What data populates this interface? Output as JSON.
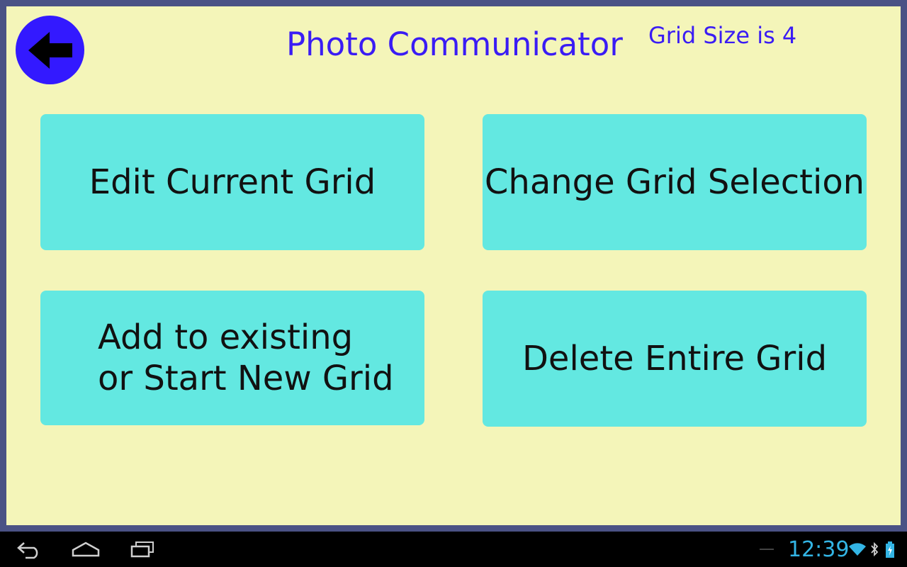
{
  "header": {
    "title": "Photo Communicator",
    "grid_size": "Grid Size is 4",
    "back_icon": "arrow-left-icon"
  },
  "menu": {
    "edit_label": "Edit Current Grid",
    "change_label": "Change Grid Selection",
    "add_label": "Add to existing\nor Start New Grid",
    "delete_label": "Delete Entire Grid"
  },
  "system_bar": {
    "time": "12:39",
    "icons": [
      "back-icon",
      "home-icon",
      "recent-apps-icon",
      "wifi-icon",
      "bluetooth-icon",
      "battery-icon"
    ]
  },
  "colors": {
    "background": "#f4f5b9",
    "button": "#63e8e1",
    "accent": "#3319ff",
    "clock": "#33b5e5"
  }
}
